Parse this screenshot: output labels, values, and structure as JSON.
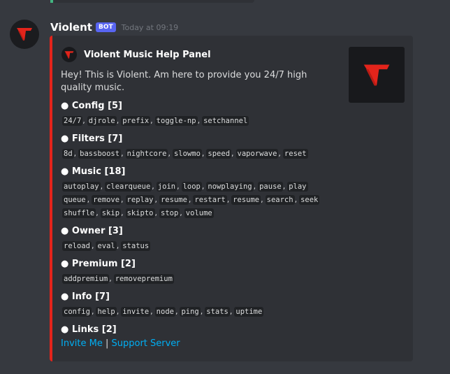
{
  "message": {
    "username": "Violent",
    "bot_tag": "BOT",
    "timestamp": "Today at 09:19"
  },
  "embed": {
    "accent_color": "#e3241b",
    "author": "Violent Music Help Panel",
    "description": "Hey! This is Violent. Am here to provide you 24/7 high quality music.",
    "sections": [
      {
        "title": "Config [5]",
        "lines": [
          [
            "24/7",
            "djrole",
            "prefix",
            "toggle-np",
            "setchannel"
          ]
        ]
      },
      {
        "title": "Filters [7]",
        "lines": [
          [
            "8d",
            "bassboost",
            "nightcore",
            "slowmo",
            "speed",
            "vaporwave",
            "reset"
          ]
        ]
      },
      {
        "title": "Music [18]",
        "lines": [
          [
            "autoplay",
            "clearqueue",
            "join",
            "loop",
            "nowplaying",
            "pause",
            "play"
          ],
          [
            "queue",
            "remove",
            "replay",
            "resume",
            "restart",
            "resume",
            "search",
            "seek"
          ],
          [
            "shuffle",
            "skip",
            "skipto",
            "stop",
            "volume"
          ]
        ]
      },
      {
        "title": "Owner [3]",
        "lines": [
          [
            "reload",
            "eval",
            "status"
          ]
        ]
      },
      {
        "title": "Premium [2]",
        "lines": [
          [
            "addpremium",
            "removepremium"
          ]
        ]
      },
      {
        "title": "Info [7]",
        "lines": [
          [
            "config",
            "help",
            "invite",
            "node",
            "ping",
            "stats",
            "uptime"
          ]
        ]
      },
      {
        "title": "Links [2]",
        "lines": []
      }
    ],
    "links": {
      "invite": "Invite Me",
      "separator": "|",
      "support": "Support Server"
    }
  },
  "icons": {
    "avatar": "violent-logo-icon",
    "author": "violent-logo-icon",
    "thumbnail": "violent-logo-icon"
  },
  "colors": {
    "link": "#00aff4",
    "logo_red": "#e3241b",
    "bot_tag": "#5865f2"
  }
}
